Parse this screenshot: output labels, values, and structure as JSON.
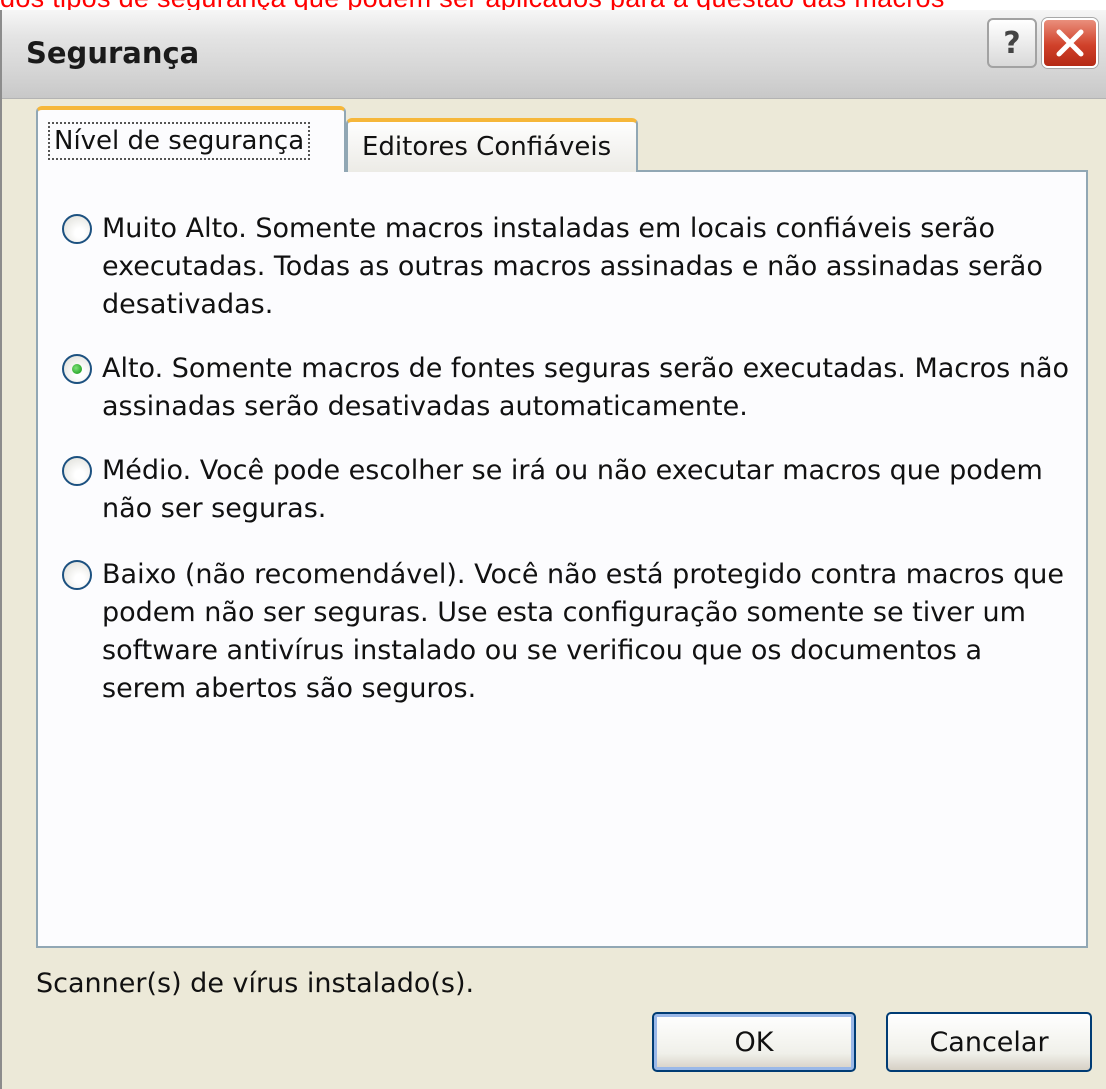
{
  "caption": "dos tipos de segurança que podem ser aplicados para a questão das macros",
  "window": {
    "title": "Segurança",
    "help_label": "?"
  },
  "tabs": [
    {
      "label": "Nível de segurança",
      "active": true
    },
    {
      "label": "Editores Confiáveis",
      "active": false
    }
  ],
  "options": [
    {
      "label": "Muito Alto. Somente macros instaladas em locais confiáveis serão executadas. Todas as outras macros assinadas e não assinadas serão desativadas.",
      "selected": false
    },
    {
      "label": "Alto. Somente macros de fontes seguras serão executadas. Macros não assinadas serão desativadas automaticamente.",
      "selected": true
    },
    {
      "label": "Médio. Você pode escolher se irá ou não executar macros que podem não ser seguras.",
      "selected": false
    },
    {
      "label": "Baixo (não recomendável). Você não está protegido contra macros que podem não ser seguras. Use esta configuração somente se tiver um software antivírus instalado ou se verificou que os documentos a serem abertos são seguros.",
      "selected": false
    }
  ],
  "status": "Scanner(s) de vírus instalado(s).",
  "buttons": {
    "ok": "OK",
    "cancel": "Cancelar"
  },
  "icons": {
    "help": "question-mark-icon",
    "close": "close-x-icon"
  },
  "colors": {
    "caption": "#ff0000",
    "tab_accent": "#f6b73a",
    "close_button": "#d0412a",
    "radio_selected": "#21a121"
  }
}
